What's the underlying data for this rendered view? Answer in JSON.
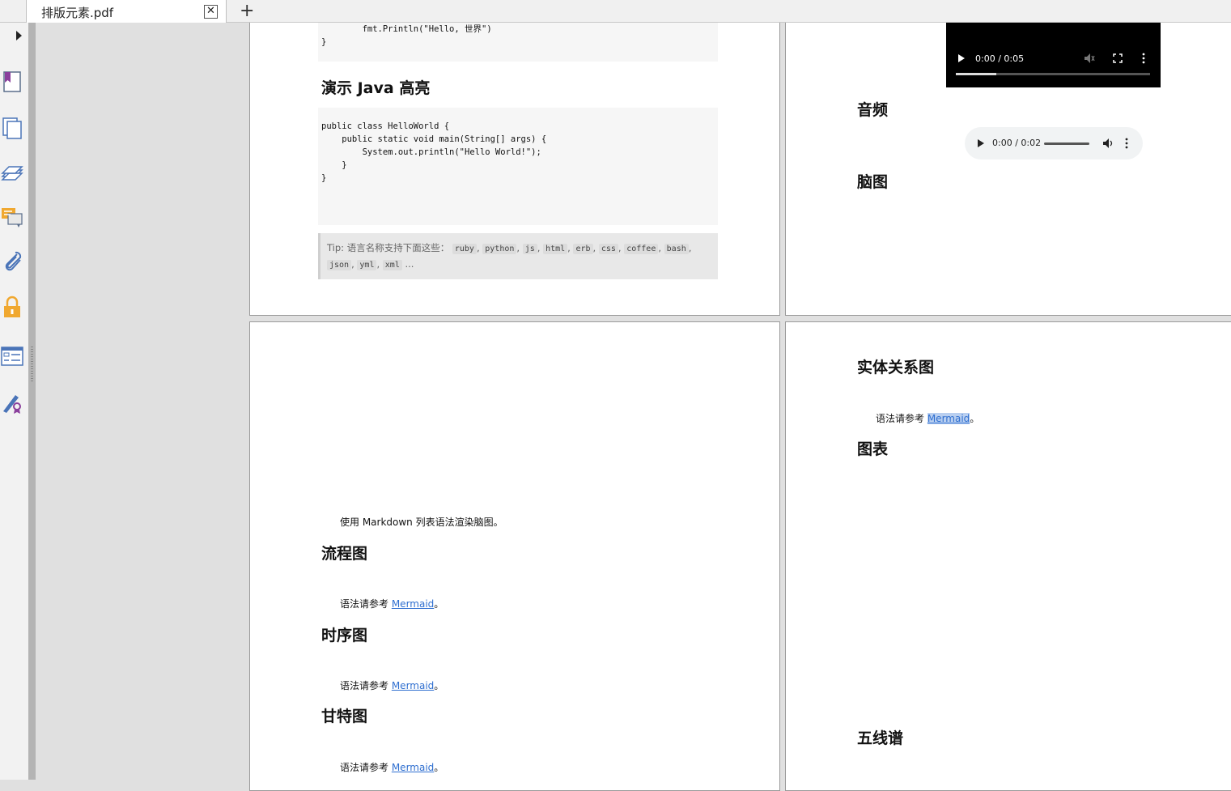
{
  "tab": {
    "title": "排版元素.pdf",
    "close": "✕",
    "new_tab": "+"
  },
  "rail_icons": [
    "bookmark-page-icon",
    "pages-icon",
    "layers-icon",
    "comments-icon",
    "attachment-icon",
    "security-lock-icon",
    "form-fields-icon",
    "signature-icon"
  ],
  "page1": {
    "code_top": [
      "        fmt.Println(\"Hello, 世界\")",
      "}"
    ],
    "heading_java": "演示 Java 高亮",
    "code_java": [
      "public class HelloWorld {",
      "",
      "    public static void main(String[] args) {",
      "        System.out.println(\"Hello World!\");",
      "    }",
      "",
      "}"
    ],
    "tip_prefix": "Tip: 语言名称支持下面这些：",
    "tip_langs": [
      "ruby",
      "python",
      "js",
      "html",
      "erb",
      "css",
      "coffee",
      "bash",
      "json",
      "yml",
      "xml"
    ],
    "tip_sep": ",",
    "tip_suffix": "..."
  },
  "page2": {
    "video_time": "0:00 / 0:05",
    "heading_audio": "音频",
    "audio_time": "0:00 / 0:02",
    "heading_mindmap": "脑图"
  },
  "page3": {
    "mindmap_text": "使用 Markdown 列表语法渲染脑图。",
    "heading_flow": "流程图",
    "ref_prefix": "语法请参考 ",
    "link": "Mermaid",
    "period": "。",
    "heading_sequence": "时序图",
    "heading_gantt": "甘特图"
  },
  "page4": {
    "heading_er": "实体关系图",
    "heading_chart": "图表",
    "heading_staff": "五线谱"
  }
}
